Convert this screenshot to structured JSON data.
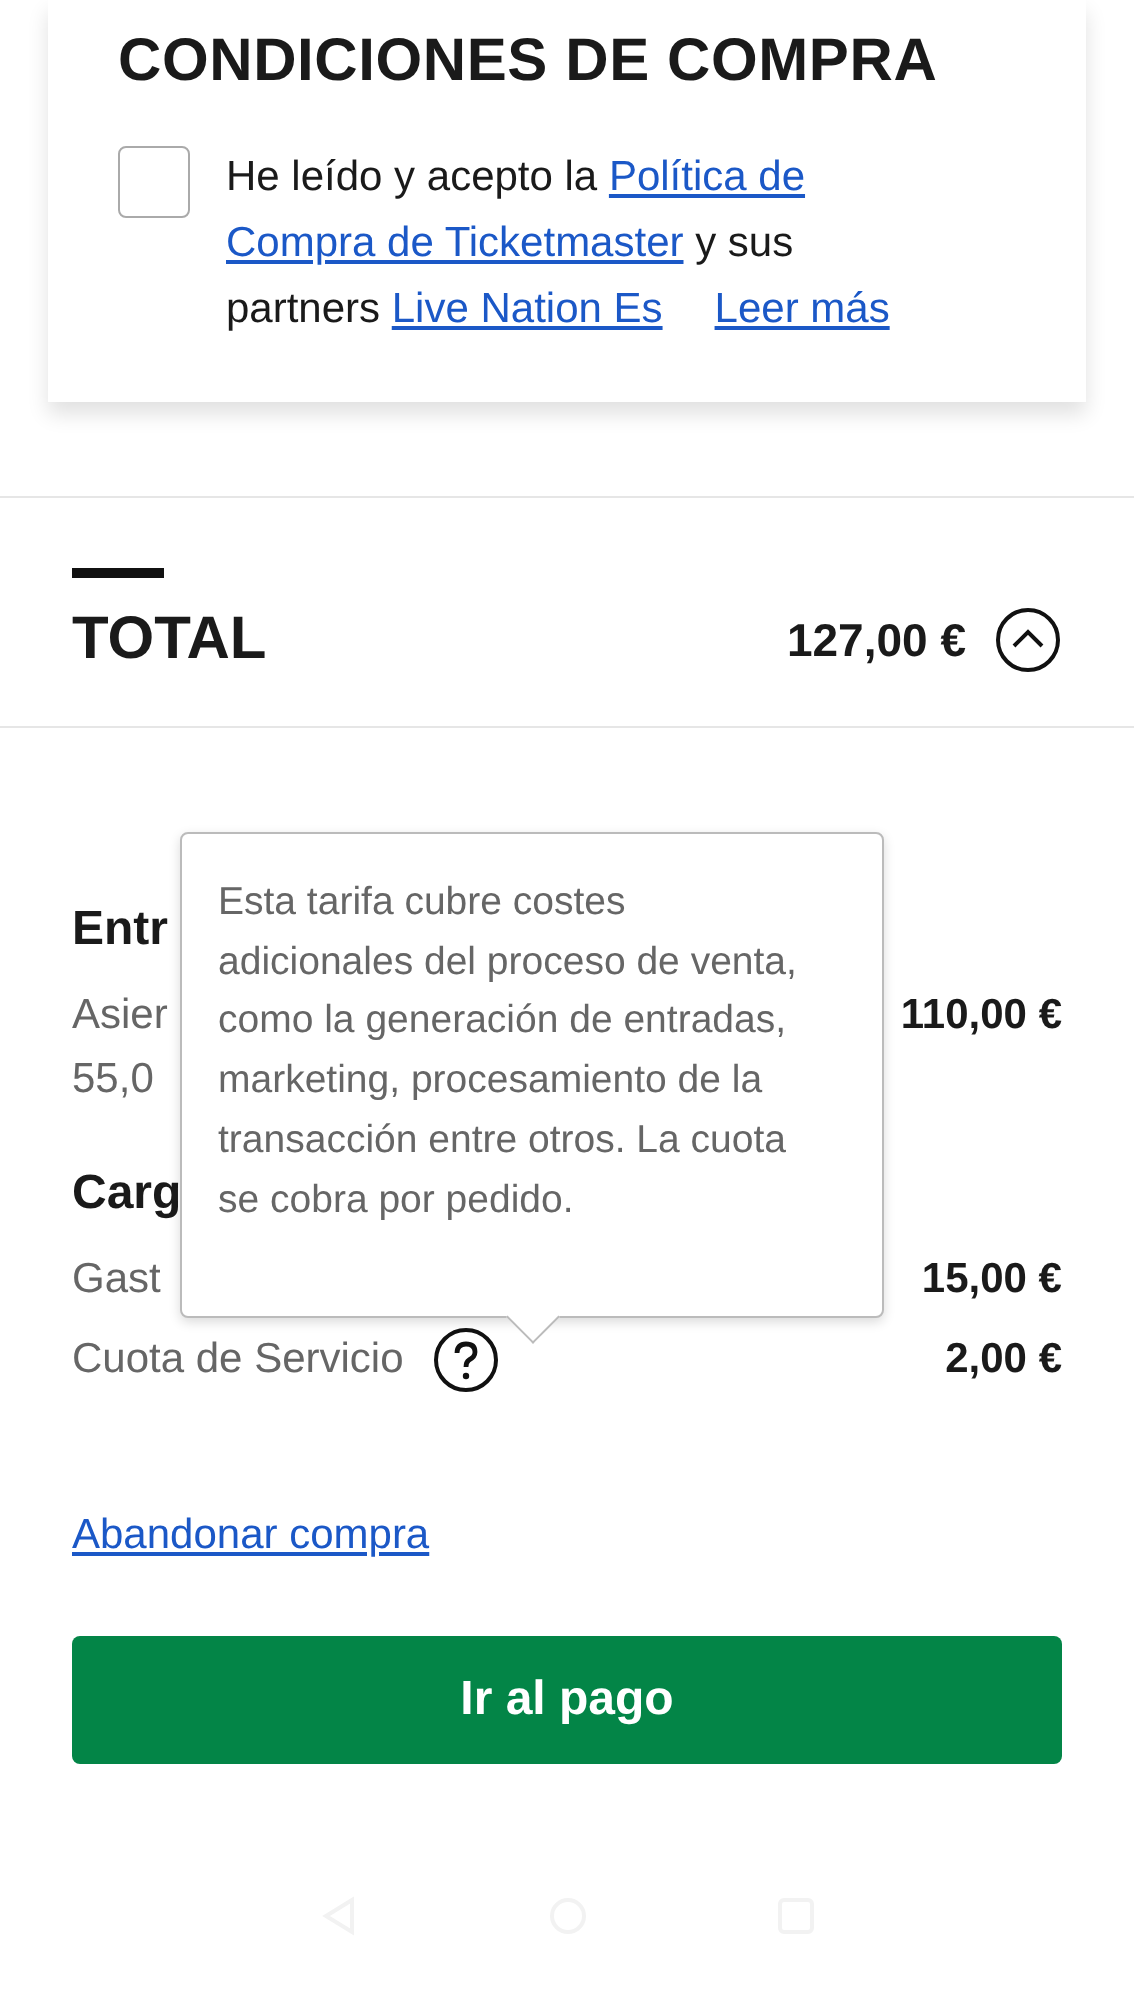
{
  "conditions": {
    "title": "CONDICIONES DE COMPRA",
    "checkbox": {
      "checked": false
    },
    "lines": [
      [
        {
          "kind": "text",
          "text": "He leído y acepto la "
        },
        {
          "kind": "link",
          "text": "Política de"
        }
      ],
      [
        {
          "kind": "link",
          "text": "Compra de Ticketmaster"
        },
        {
          "kind": "text",
          "text": " y sus"
        }
      ],
      [
        {
          "kind": "text",
          "text": "partners "
        },
        {
          "kind": "link",
          "text": "Live Nation Es"
        },
        {
          "kind": "more",
          "text": "Leer más"
        }
      ]
    ]
  },
  "total": {
    "label": "TOTAL",
    "amount": "127,00 €",
    "expanded": true
  },
  "sections": [
    {
      "title": "Entr",
      "rows": [
        {
          "label": "Asier",
          "sub": "55,0",
          "amount": "110,00 €",
          "help": false
        }
      ]
    },
    {
      "title": "Carg",
      "rows": [
        {
          "label": "Gast",
          "amount": "15,00 €",
          "help": false
        },
        {
          "label": "Cuota de Servicio",
          "amount": "2,00 €",
          "help": true
        }
      ]
    }
  ],
  "tooltip": {
    "text": "Esta tarifa cubre costes adicionales del proceso de venta, como la generación de entradas, marketing, procesamiento de la transacción entre otros. La cuota se cobra por pedido."
  },
  "abandon_link": "Abandonar compra",
  "pay_button": "Ir al pago"
}
